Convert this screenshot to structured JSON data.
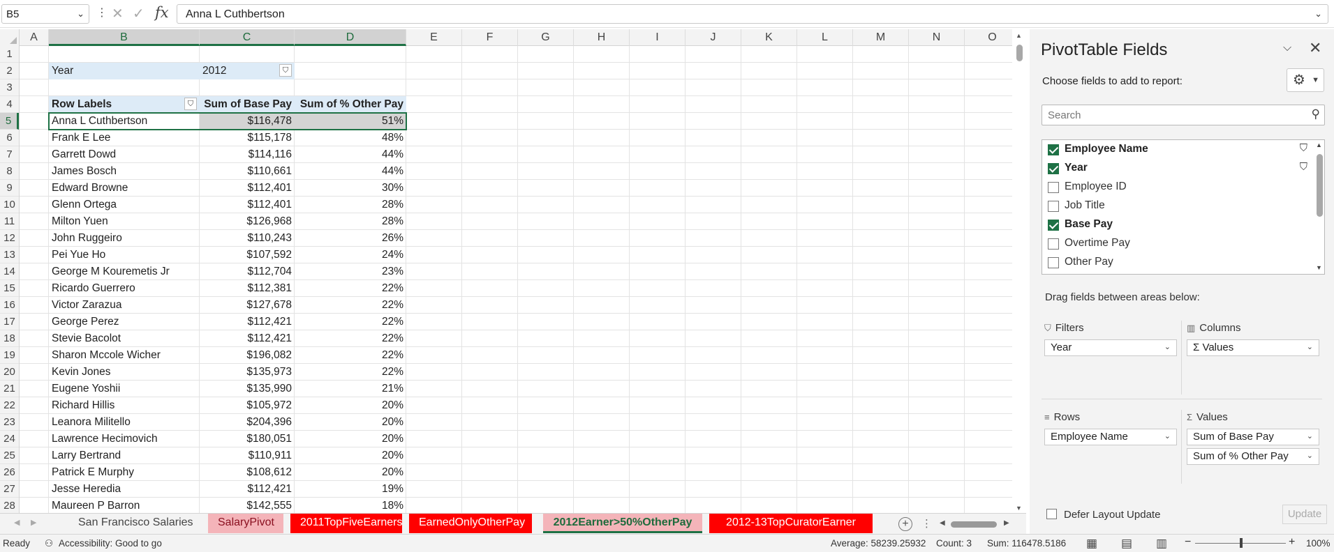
{
  "formula_bar": {
    "name_box": "B5",
    "formula": "Anna L Cuthbertson",
    "fx_label": "fx"
  },
  "columns": [
    "A",
    "B",
    "C",
    "D",
    "E",
    "F",
    "G",
    "H",
    "I",
    "J",
    "K",
    "L",
    "M",
    "N",
    "O"
  ],
  "rows": [
    "1",
    "2",
    "3",
    "4",
    "5",
    "6",
    "7",
    "8",
    "9",
    "10",
    "11",
    "12",
    "13",
    "14",
    "15",
    "16",
    "17",
    "18",
    "19",
    "20",
    "21",
    "22",
    "23",
    "24",
    "25",
    "26",
    "27",
    "28"
  ],
  "pivot": {
    "filter_label": "Year",
    "filter_value": "2012",
    "header": {
      "row_labels": "Row Labels",
      "col1": "Sum of Base Pay",
      "col2": "Sum of % Other Pay"
    },
    "records": [
      {
        "name": "Anna L Cuthbertson",
        "base": "$116,478",
        "pct": "51%"
      },
      {
        "name": "Frank E Lee",
        "base": "$115,178",
        "pct": "48%"
      },
      {
        "name": "Garrett Dowd",
        "base": "$114,116",
        "pct": "44%"
      },
      {
        "name": "James Bosch",
        "base": "$110,661",
        "pct": "44%"
      },
      {
        "name": "Edward Browne",
        "base": "$112,401",
        "pct": "30%"
      },
      {
        "name": "Glenn Ortega",
        "base": "$112,401",
        "pct": "28%"
      },
      {
        "name": "Milton Yuen",
        "base": "$126,968",
        "pct": "28%"
      },
      {
        "name": "John Ruggeiro",
        "base": "$110,243",
        "pct": "26%"
      },
      {
        "name": "Pei Yue Ho",
        "base": "$107,592",
        "pct": "24%"
      },
      {
        "name": "George M Kouremetis Jr",
        "base": "$112,704",
        "pct": "23%"
      },
      {
        "name": "Ricardo Guerrero",
        "base": "$112,381",
        "pct": "22%"
      },
      {
        "name": "Victor Zarazua",
        "base": "$127,678",
        "pct": "22%"
      },
      {
        "name": "George Perez",
        "base": "$112,421",
        "pct": "22%"
      },
      {
        "name": "Stevie Bacolot",
        "base": "$112,421",
        "pct": "22%"
      },
      {
        "name": "Sharon Mccole Wicher",
        "base": "$196,082",
        "pct": "22%"
      },
      {
        "name": "Kevin Jones",
        "base": "$135,973",
        "pct": "22%"
      },
      {
        "name": "Eugene Yoshii",
        "base": "$135,990",
        "pct": "21%"
      },
      {
        "name": "Richard Hillis",
        "base": "$105,972",
        "pct": "20%"
      },
      {
        "name": "Leanora Militello",
        "base": "$204,396",
        "pct": "20%"
      },
      {
        "name": "Lawrence  Hecimovich",
        "base": "$180,051",
        "pct": "20%"
      },
      {
        "name": "Larry Bertrand",
        "base": "$110,911",
        "pct": "20%"
      },
      {
        "name": "Patrick E Murphy",
        "base": "$108,612",
        "pct": "20%"
      },
      {
        "name": "Jesse Heredia",
        "base": "$112,421",
        "pct": "19%"
      },
      {
        "name": "Maureen P Barron",
        "base": "$142,555",
        "pct": "18%"
      }
    ]
  },
  "sheet_tabs": [
    {
      "label": "San Francisco Salaries",
      "style": "plain"
    },
    {
      "label": "SalaryPivot",
      "style": "pink"
    },
    {
      "label": "2011TopFiveEarners",
      "style": "red"
    },
    {
      "label": "EarnedOnlyOtherPay",
      "style": "red"
    },
    {
      "label": "2012Earner>50%OtherPay",
      "style": "active"
    },
    {
      "label": "2012-13TopCuratorEarner",
      "style": "red"
    }
  ],
  "status": {
    "ready": "Ready",
    "accessibility": "Accessibility: Good to go",
    "average": "Average: 58239.25932",
    "count": "Count: 3",
    "sum": "Sum: 116478.5186",
    "zoom": "100%"
  },
  "pane": {
    "title": "PivotTable Fields",
    "subtitle": "Choose fields to add to report:",
    "search_placeholder": "Search",
    "fields": [
      {
        "label": "Employee Name",
        "checked": true,
        "filtered": true
      },
      {
        "label": "Year",
        "checked": true,
        "filtered": true
      },
      {
        "label": "Employee ID",
        "checked": false,
        "filtered": false
      },
      {
        "label": "Job Title",
        "checked": false,
        "filtered": false
      },
      {
        "label": "Base Pay",
        "checked": true,
        "filtered": false
      },
      {
        "label": "Overtime Pay",
        "checked": false,
        "filtered": false
      },
      {
        "label": "Other Pay",
        "checked": false,
        "filtered": false
      }
    ],
    "drag_text": "Drag fields between areas below:",
    "areas": {
      "filters": {
        "title": "Filters",
        "items": [
          "Year"
        ]
      },
      "columns": {
        "title": "Columns",
        "items": [
          "Σ Values"
        ]
      },
      "rows": {
        "title": "Rows",
        "items": [
          "Employee Name"
        ]
      },
      "values": {
        "title": "Values",
        "items": [
          "Sum of Base Pay",
          "Sum of % Other Pay"
        ]
      }
    },
    "defer_label": "Defer Layout Update",
    "update_label": "Update"
  }
}
